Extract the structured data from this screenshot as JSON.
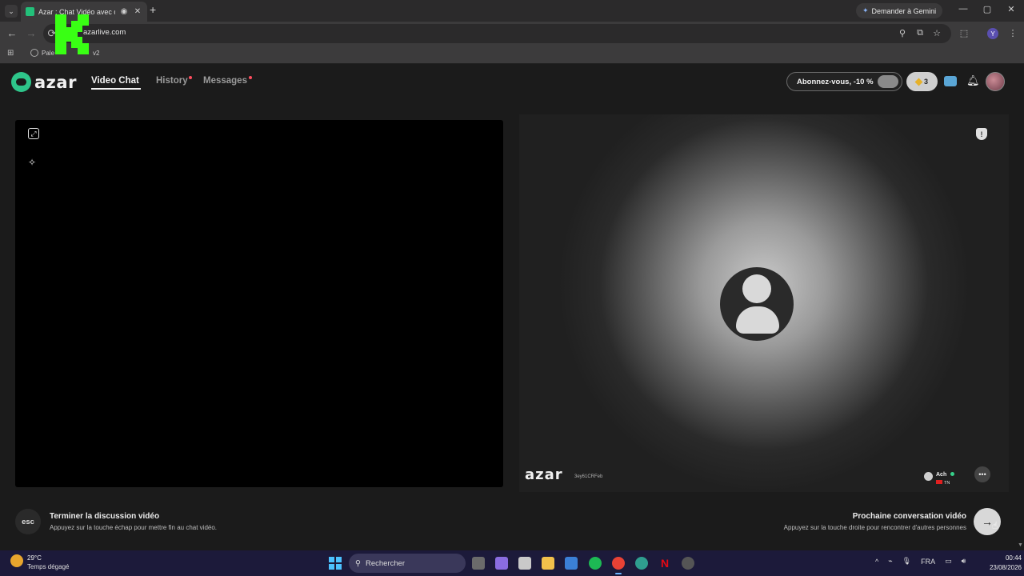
{
  "browser": {
    "tab_title": "Azar : Chat Vidéo avec de n",
    "tab_close": "✕",
    "new_tab": "+",
    "gemini_label": "Demander à Gemini",
    "url": "azarlive.com",
    "bookmark_label": "Pale",
    "bookmark_suffix": "v2",
    "profile_initial": "Y",
    "window_controls": [
      "—",
      "▢",
      "✕"
    ]
  },
  "app": {
    "nav": {
      "video_chat": "Video Chat",
      "history": "History",
      "messages": "Messages"
    },
    "subscribe_label": "Abonnez-vous, -10 %",
    "gems_count": "3",
    "remote": {
      "watermark": "azar",
      "user_code": "3ey61CRFeb",
      "user_name": "Ach",
      "user_country": "TN"
    },
    "footer": {
      "esc_key": "esc",
      "end_title": "Terminer la discussion vidéo",
      "end_sub": "Appuyez sur la touche échap pour mettre fin au chat vidéo.",
      "next_title": "Prochaine conversation vidéo",
      "next_sub": "Appuyez sur la touche droite pour rencontrer d'autres personnes",
      "next_arrow": "→"
    }
  },
  "taskbar": {
    "weather_temp": "29°C",
    "weather_desc": "Temps dégagé",
    "search_placeholder": "Rechercher",
    "language": "FRA",
    "time": "00:44",
    "date": "23/08/2026"
  },
  "colors": {
    "accent_green": "#2ec58a",
    "notification_red": "#ff4d5e",
    "taskbar_bg": "#1c1a3a"
  }
}
